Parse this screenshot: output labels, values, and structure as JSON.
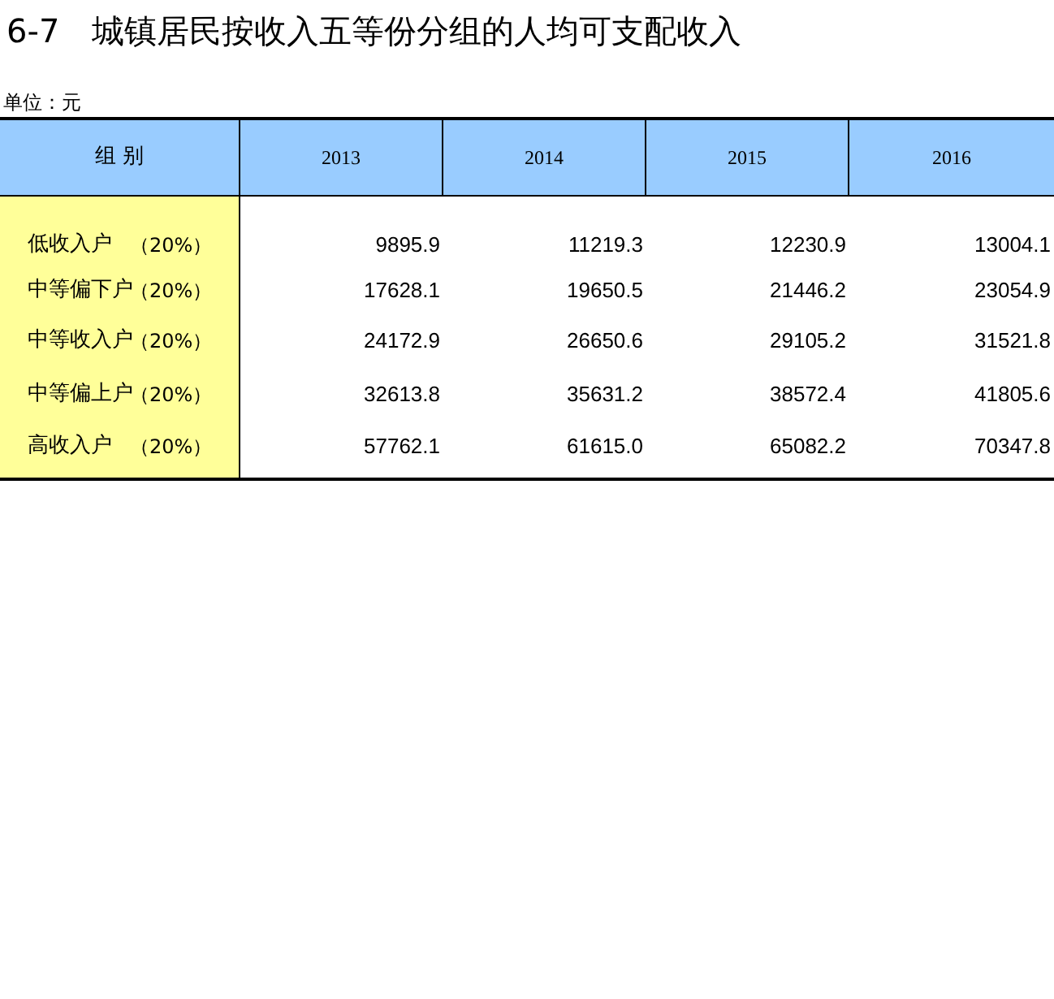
{
  "title": "6-7　城镇居民按收入五等份分组的人均可支配收入",
  "unit": "单位：元",
  "table": {
    "columns": [
      "组 别",
      "2013",
      "2014",
      "2015",
      "2016"
    ],
    "rows": [
      {
        "group": "低收入户",
        "share": "（20%）",
        "values": [
          "9895.9",
          "11219.3",
          "12230.9",
          "13004.1"
        ]
      },
      {
        "group": "中等偏下户",
        "share": "（20%）",
        "values": [
          "17628.1",
          "19650.5",
          "21446.2",
          "23054.9"
        ]
      },
      {
        "group": "中等收入户",
        "share": "（20%）",
        "values": [
          "24172.9",
          "26650.6",
          "29105.2",
          "31521.8"
        ]
      },
      {
        "group": "中等偏上户",
        "share": "（20%）",
        "values": [
          "32613.8",
          "35631.2",
          "38572.4",
          "41805.6"
        ]
      },
      {
        "group": "高收入户",
        "share": "（20%）",
        "values": [
          "57762.1",
          "61615.0",
          "65082.2",
          "70347.8"
        ]
      }
    ]
  }
}
